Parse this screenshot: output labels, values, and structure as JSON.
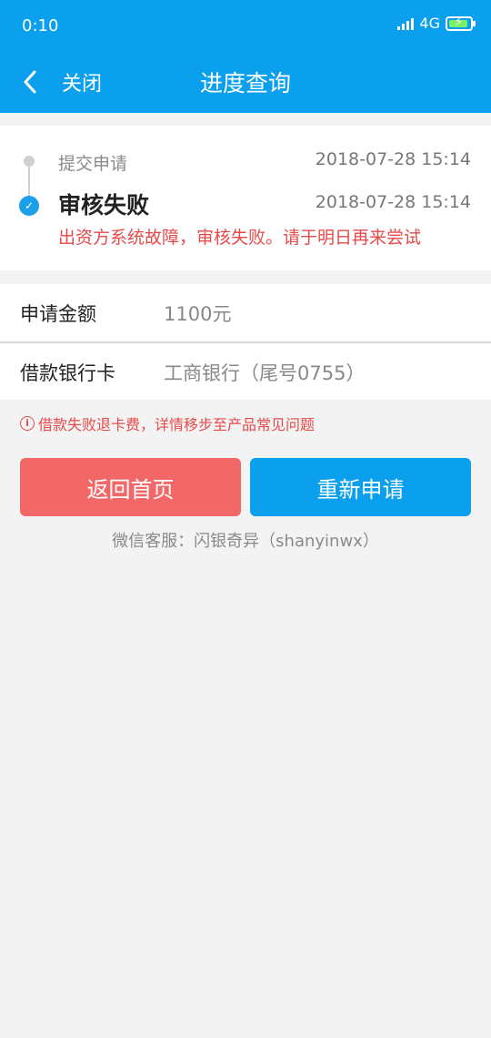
{
  "status_bar": {
    "time": "0:10",
    "network": "4G"
  },
  "nav": {
    "back_icon": "chevron-left-icon",
    "close_label": "关闭",
    "title": "进度查询"
  },
  "timeline": {
    "steps": [
      {
        "label": "提交申请",
        "time": "2018-07-28 15:14"
      },
      {
        "label": "审核失败",
        "time": "2018-07-28 15:14",
        "message": "出资方系统故障，审核失败。请于明日再来尝试"
      }
    ]
  },
  "info": {
    "rows": [
      {
        "label": "申请金额",
        "value": "1100元"
      },
      {
        "label": "借款银行卡",
        "value": "工商银行（尾号0755）"
      }
    ]
  },
  "notice": {
    "icon": "warning-icon",
    "text": "借款失败退卡费，详情移步至产品常见问题"
  },
  "actions": {
    "home_label": "返回首页",
    "reapply_label": "重新申请"
  },
  "service_text": "微信客服：闪银奇异（shanyinwx）",
  "colors": {
    "header": "#0aa0ee",
    "error": "#e64a4a",
    "home_button": "#f26868",
    "reapply_button": "#0aa0ee"
  }
}
